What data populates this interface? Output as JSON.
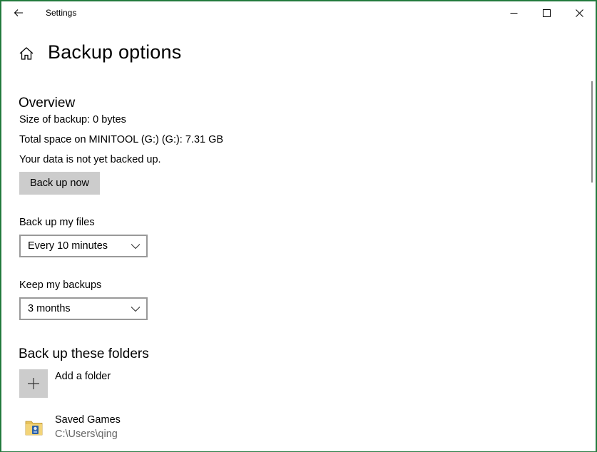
{
  "titlebar": {
    "app_title": "Settings"
  },
  "page": {
    "title": "Backup options"
  },
  "overview": {
    "heading": "Overview",
    "size_of_backup": "Size of backup: 0 bytes",
    "total_space": "Total space on MINITOOL (G:) (G:): 7.31 GB",
    "status": "Your data is not yet backed up.",
    "back_up_now_label": "Back up now"
  },
  "frequency": {
    "label": "Back up my files",
    "selected": "Every 10 minutes"
  },
  "retention": {
    "label": "Keep my backups",
    "selected": "3 months"
  },
  "folders": {
    "heading": "Back up these folders",
    "add_label": "Add a folder",
    "items": [
      {
        "name": "Saved Games",
        "path": "C:\\Users\\qing"
      }
    ]
  },
  "icons": {
    "back": "back-arrow-icon",
    "minimize": "minimize-icon",
    "maximize": "maximize-icon",
    "close": "close-icon",
    "home": "home-icon",
    "chevron": "chevron-down-icon",
    "add": "plus-icon",
    "folder": "saved-games-folder-icon"
  },
  "colors": {
    "button_bg": "#cccccc",
    "window_border": "#2d7d46",
    "dropdown_border": "#999999",
    "secondary_text": "#666666"
  }
}
